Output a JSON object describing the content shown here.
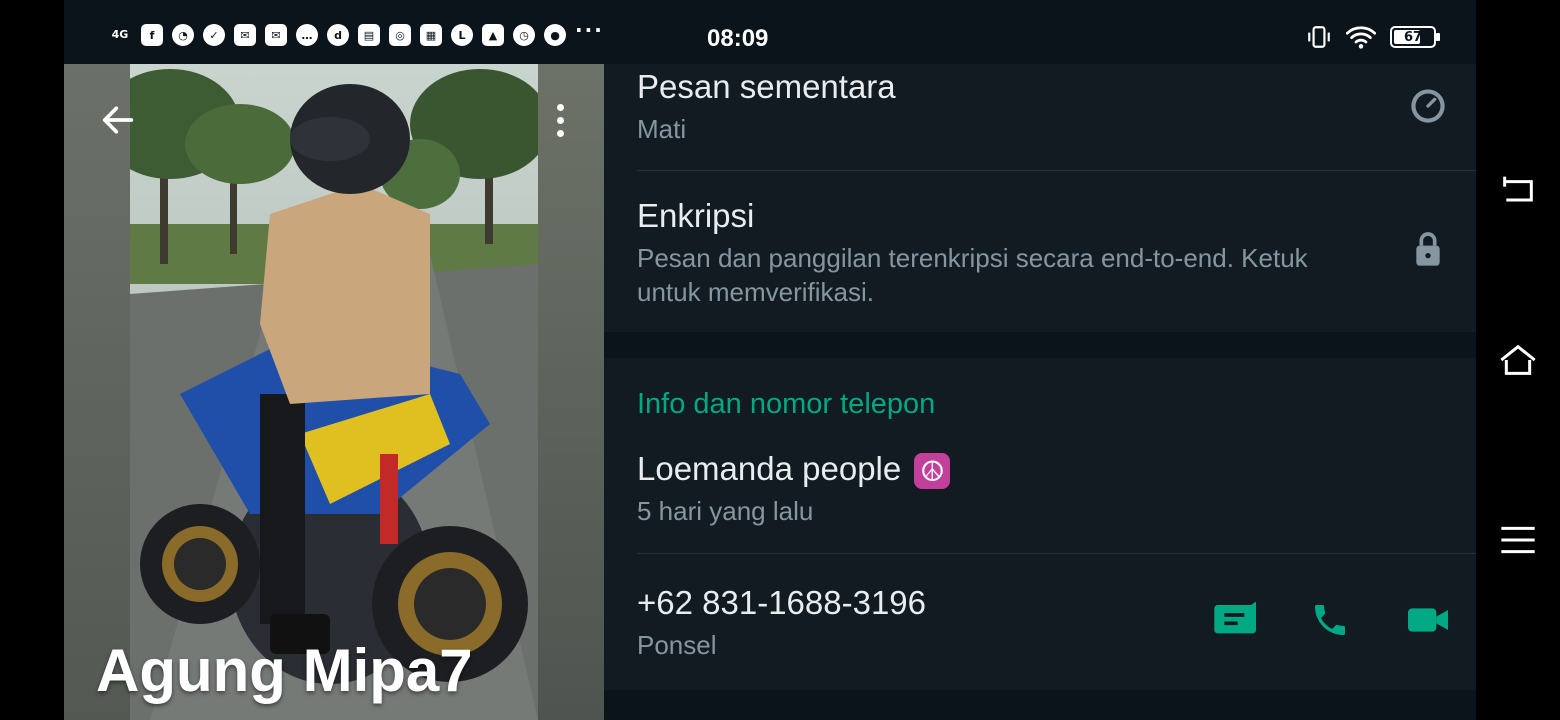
{
  "status_bar": {
    "network": "4G",
    "time": "08:09",
    "battery_level": "67",
    "notification_icons": [
      "facebook-icon",
      "speedometer-icon",
      "check-icon",
      "mail-icon",
      "mail-alt-icon",
      "chat-icon",
      "d-app-icon",
      "news-icon",
      "instagram-icon",
      "card-icon",
      "laz-icon",
      "gallery-icon",
      "alarm-icon",
      "mic-icon"
    ],
    "more": "···"
  },
  "profile": {
    "name": "Agung Mipa7"
  },
  "disappearing": {
    "title": "Pesan sementara",
    "value": "Mati"
  },
  "encryption": {
    "title": "Enkripsi",
    "description": "Pesan dan panggilan terenkripsi secara end-to-end. Ketuk untuk memverifikasi."
  },
  "info_section": {
    "header": "Info dan nomor telepon",
    "about_text": "Loemanda people",
    "about_emoji": "☮",
    "about_date": "5 hari yang lalu",
    "phone_number": "+62 831-1688-3196",
    "phone_type": "Ponsel"
  },
  "colors": {
    "accent": "#00a884",
    "panel_bg": "#111b21",
    "divider": "#233138",
    "secondary_text": "#8696a0"
  }
}
